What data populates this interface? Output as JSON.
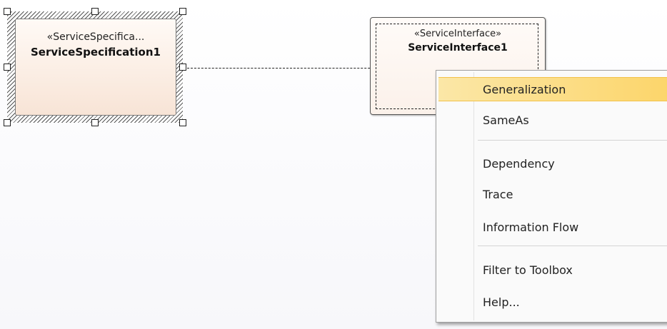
{
  "diagram": {
    "service_specification": {
      "stereotype": "«ServiceSpecifica...",
      "name": "ServiceSpecification1"
    },
    "service_interface": {
      "stereotype": "«ServiceInterface»",
      "name": "ServiceInterface1"
    }
  },
  "context_menu": {
    "highlight_color": "#fcd56a",
    "items": [
      {
        "label": "Generalization"
      },
      {
        "label": "SameAs"
      },
      {
        "label": "Dependency"
      },
      {
        "label": "Trace"
      },
      {
        "label": "Information Flow"
      },
      {
        "label": "Filter to Toolbox"
      },
      {
        "label": "Help..."
      }
    ]
  }
}
